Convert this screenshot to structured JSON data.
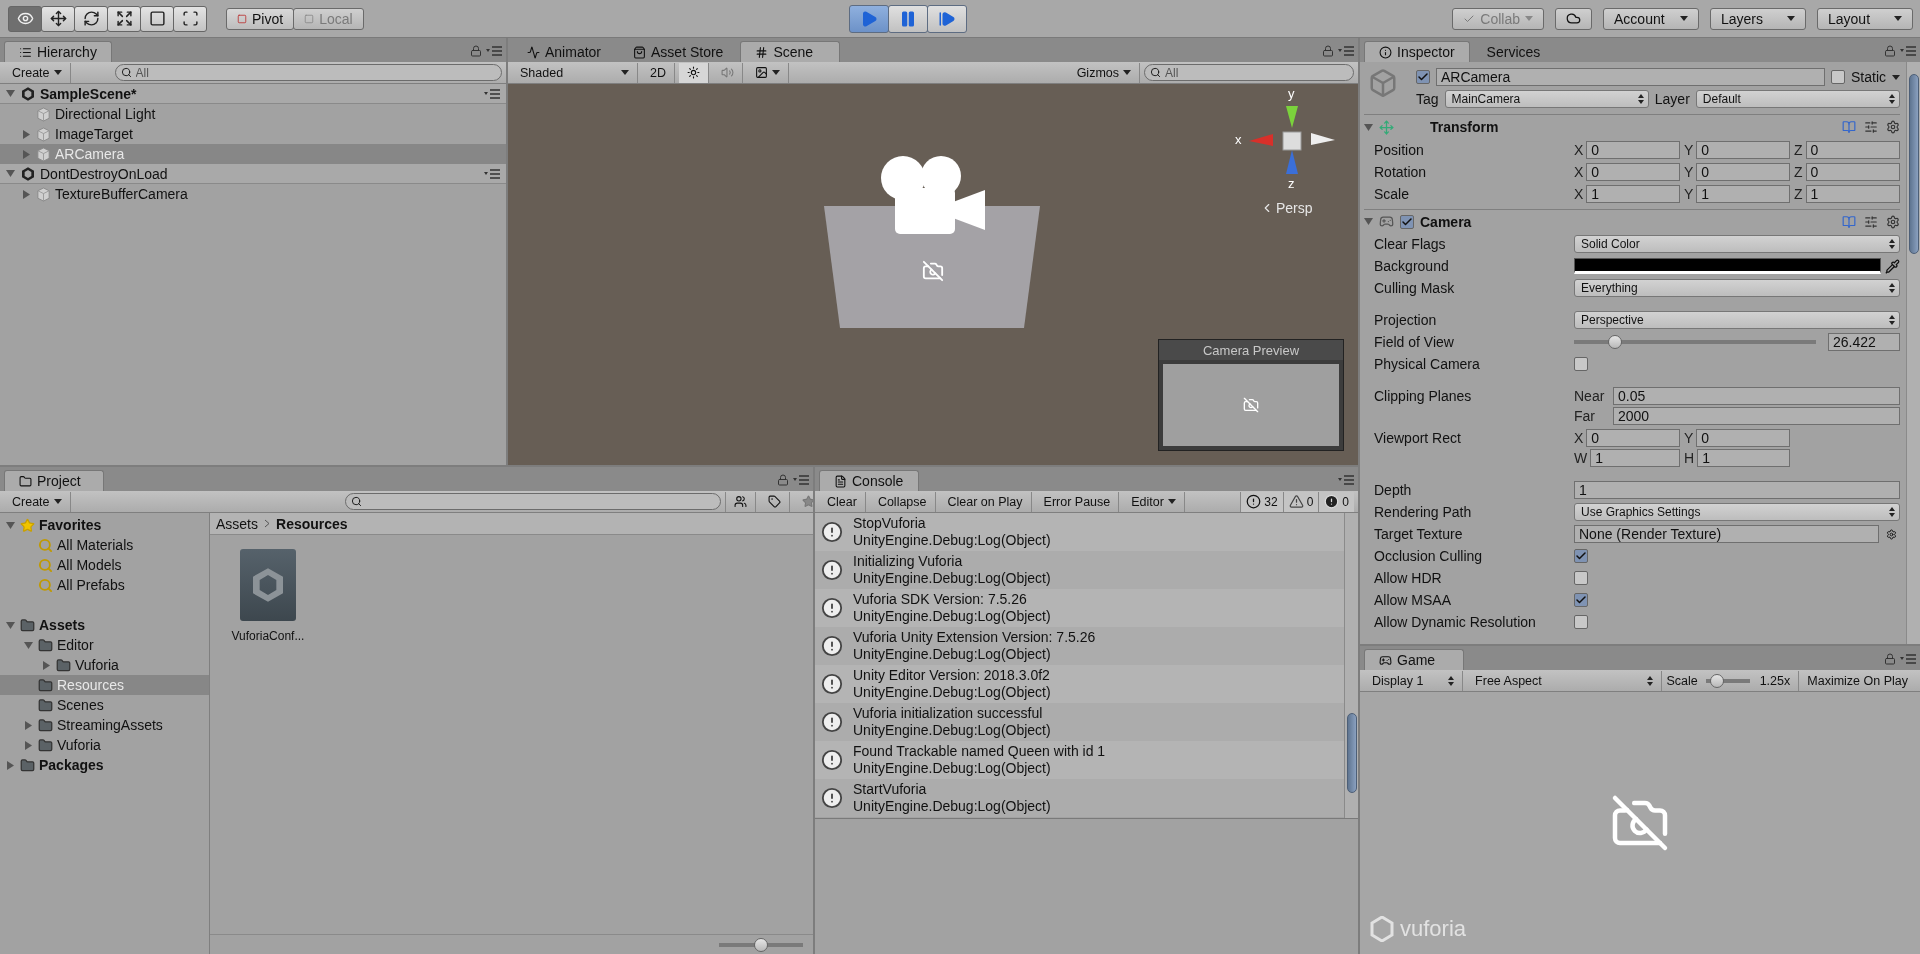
{
  "toolbar": {
    "tools": [
      {
        "kind": "view",
        "selected": true
      },
      {
        "kind": "move",
        "selected": false
      },
      {
        "kind": "rotate",
        "selected": false
      },
      {
        "kind": "scale",
        "selected": false
      },
      {
        "kind": "rect",
        "selected": false
      },
      {
        "kind": "transform",
        "selected": false
      }
    ],
    "pivot": [
      {
        "label": "Pivot",
        "selected": true
      },
      {
        "label": "Local",
        "selected": false
      }
    ],
    "play": [
      {
        "kind": "play",
        "selected": true
      },
      {
        "kind": "pause",
        "selected": false
      },
      {
        "kind": "step",
        "selected": false
      }
    ],
    "collab": {
      "label": "Collab",
      "disabled": true
    },
    "account": "Account",
    "layers": "Layers",
    "layout": "Layout"
  },
  "hierarchy": {
    "tab": "Hierarchy",
    "create": "Create",
    "search": {
      "placeholder": "All"
    },
    "items": [
      {
        "kind": "scene",
        "name": "SampleScene*",
        "active": true,
        "expanded": true,
        "selected": false,
        "children": [
          {
            "kind": "object",
            "name": "Directional Light",
            "selected": false
          },
          {
            "kind": "object",
            "name": "ImageTarget",
            "expanded": false,
            "selected": false
          },
          {
            "kind": "object",
            "name": "ARCamera",
            "expanded": false,
            "selected": true
          }
        ]
      },
      {
        "kind": "scene",
        "name": "DontDestroyOnLoad",
        "active": false,
        "expanded": true,
        "selected": false,
        "children": [
          {
            "kind": "object",
            "name": "TextureBufferCamera",
            "expanded": false,
            "selected": false
          }
        ]
      }
    ]
  },
  "scene": {
    "tabs": [
      {
        "kind": "animator",
        "label": "Animator",
        "selected": false
      },
      {
        "kind": "store",
        "label": "Asset Store",
        "selected": false
      },
      {
        "kind": "scene",
        "label": "Scene",
        "selected": true
      }
    ],
    "shading": "Shaded",
    "mode_2d": "2D",
    "lighting": {
      "on": true
    },
    "audio": {
      "on": false
    },
    "gizmos": "Gizmos",
    "search": {
      "placeholder": "All"
    },
    "axes": {
      "x": "x",
      "y": "y",
      "z": "z"
    },
    "projection": "Persp",
    "preview": {
      "title": "Camera Preview"
    }
  },
  "inspector": {
    "tabs": [
      {
        "label": "Inspector",
        "selected": true
      },
      {
        "label": "Services",
        "selected": false
      }
    ],
    "object": {
      "enabled": true,
      "name": "ARCamera",
      "static": false,
      "static_label": "Static",
      "tag_label": "Tag",
      "tag": "MainCamera",
      "layer_label": "Layer",
      "layer": "Default"
    },
    "transform": {
      "title": "Transform",
      "rows": [
        {
          "label": "Position",
          "fields": [
            {
              "axis": "X",
              "value": "0"
            },
            {
              "axis": "Y",
              "value": "0"
            },
            {
              "axis": "Z",
              "value": "0"
            }
          ]
        },
        {
          "label": "Rotation",
          "fields": [
            {
              "axis": "X",
              "value": "0"
            },
            {
              "axis": "Y",
              "value": "0"
            },
            {
              "axis": "Z",
              "value": "0"
            }
          ]
        },
        {
          "label": "Scale",
          "fields": [
            {
              "axis": "X",
              "value": "1"
            },
            {
              "axis": "Y",
              "value": "1"
            },
            {
              "axis": "Z",
              "value": "1"
            }
          ]
        }
      ]
    },
    "camera": {
      "title": "Camera",
      "enabled": true,
      "props": [
        {
          "kind": "dropdown",
          "label": "Clear Flags",
          "value": "Solid Color"
        },
        {
          "kind": "swatch",
          "label": "Background"
        },
        {
          "kind": "dropdown",
          "label": "Culling Mask",
          "value": "Everything"
        },
        {
          "kind": "dropdown",
          "label": "Projection",
          "value": "Perspective",
          "spaced": true
        },
        {
          "kind": "slider",
          "label": "Field of View",
          "level": 0.15,
          "value": "26.422"
        },
        {
          "kind": "checkbox",
          "label": "Physical Camera",
          "checked": false
        },
        {
          "kind": "pair",
          "label": "Clipping Planes",
          "spaced": true,
          "fields": [
            {
              "axis": "Near",
              "value": "0.05"
            },
            {
              "axis": "Far",
              "value": "2000"
            }
          ]
        },
        {
          "kind": "rect",
          "label": "Viewport Rect",
          "fields": [
            {
              "axis": "X",
              "value": "0"
            },
            {
              "axis": "Y",
              "value": "0"
            },
            {
              "axis": "W",
              "value": "1"
            },
            {
              "axis": "H",
              "value": "1"
            }
          ]
        },
        {
          "kind": "text",
          "label": "Depth",
          "value": "1",
          "spaced": true
        },
        {
          "kind": "dropdown",
          "label": "Rendering Path",
          "value": "Use Graphics Settings"
        },
        {
          "kind": "object",
          "label": "Target Texture",
          "value": "None (Render Texture)"
        },
        {
          "kind": "checkbox",
          "label": "Occlusion Culling",
          "checked": true
        },
        {
          "kind": "checkbox",
          "label": "Allow HDR",
          "checked": false
        },
        {
          "kind": "checkbox",
          "label": "Allow MSAA",
          "checked": true
        },
        {
          "kind": "checkbox",
          "label": "Allow Dynamic Resolution",
          "checked": false
        }
      ]
    }
  },
  "game": {
    "tab": "Game",
    "display": "Display 1",
    "aspect": "Free Aspect",
    "scale_label": "Scale",
    "scale": {
      "level": 0.15
    },
    "scale_value": "1.25x",
    "maximize": "Maximize On Play",
    "logo": "vuforia"
  },
  "project": {
    "tab": "Project",
    "create": "Create",
    "tree": [
      {
        "kind": "favorites",
        "name": "Favorites",
        "expanded": true,
        "selected": false,
        "children": [
          {
            "kind": "search",
            "name": "All Materials",
            "selected": false
          },
          {
            "kind": "search",
            "name": "All Models",
            "selected": false
          },
          {
            "kind": "search",
            "name": "All Prefabs",
            "selected": false
          }
        ]
      },
      {
        "kind": "folder",
        "name": "Assets",
        "expanded": true,
        "selected": false,
        "children": [
          {
            "kind": "folder",
            "name": "Editor",
            "expanded": true,
            "selected": false,
            "children": [
              {
                "kind": "folder",
                "name": "Vuforia",
                "expanded": false,
                "selected": false
              }
            ]
          },
          {
            "kind": "folder",
            "name": "Resources",
            "selected": true
          },
          {
            "kind": "folder",
            "name": "Scenes",
            "selected": false
          },
          {
            "kind": "folder",
            "name": "StreamingAssets",
            "expanded": false,
            "selected": false
          },
          {
            "kind": "folder",
            "name": "Vuforia",
            "expanded": false,
            "selected": false
          }
        ]
      },
      {
        "kind": "folder",
        "name": "Packages",
        "expanded": false,
        "selected": false
      }
    ],
    "breadcrumb": [
      "Assets",
      "Resources"
    ],
    "files": [
      {
        "name": "VuforiaConf..."
      }
    ],
    "zoom": {
      "level": 0.5
    }
  },
  "console": {
    "tab": "Console",
    "buttons": [
      "Clear",
      "Collapse",
      "Clear on Play",
      "Error Pause"
    ],
    "filter": "Editor",
    "counts": [
      {
        "kind": "info",
        "count": "32"
      },
      {
        "kind": "warning",
        "count": "0"
      },
      {
        "kind": "error",
        "count": "0"
      }
    ],
    "messages": [
      {
        "text": "StopVuforia",
        "detail": "UnityEngine.Debug:Log(Object)"
      },
      {
        "text": "Initializing Vuforia",
        "detail": "UnityEngine.Debug:Log(Object)"
      },
      {
        "text": "Vuforia SDK Version: 7.5.26",
        "detail": "UnityEngine.Debug:Log(Object)"
      },
      {
        "text": "Vuforia Unity Extension Version: 7.5.26",
        "detail": "UnityEngine.Debug:Log(Object)"
      },
      {
        "text": "Unity Editor Version: 2018.3.0f2",
        "detail": "UnityEngine.Debug:Log(Object)"
      },
      {
        "text": "Vuforia initialization successful",
        "detail": "UnityEngine.Debug:Log(Object)"
      },
      {
        "text": "Found Trackable named Queen with id 1",
        "detail": "UnityEngine.Debug:Log(Object)"
      },
      {
        "text": "StartVuforia",
        "detail": "UnityEngine.Debug:Log(Object)"
      }
    ]
  }
}
